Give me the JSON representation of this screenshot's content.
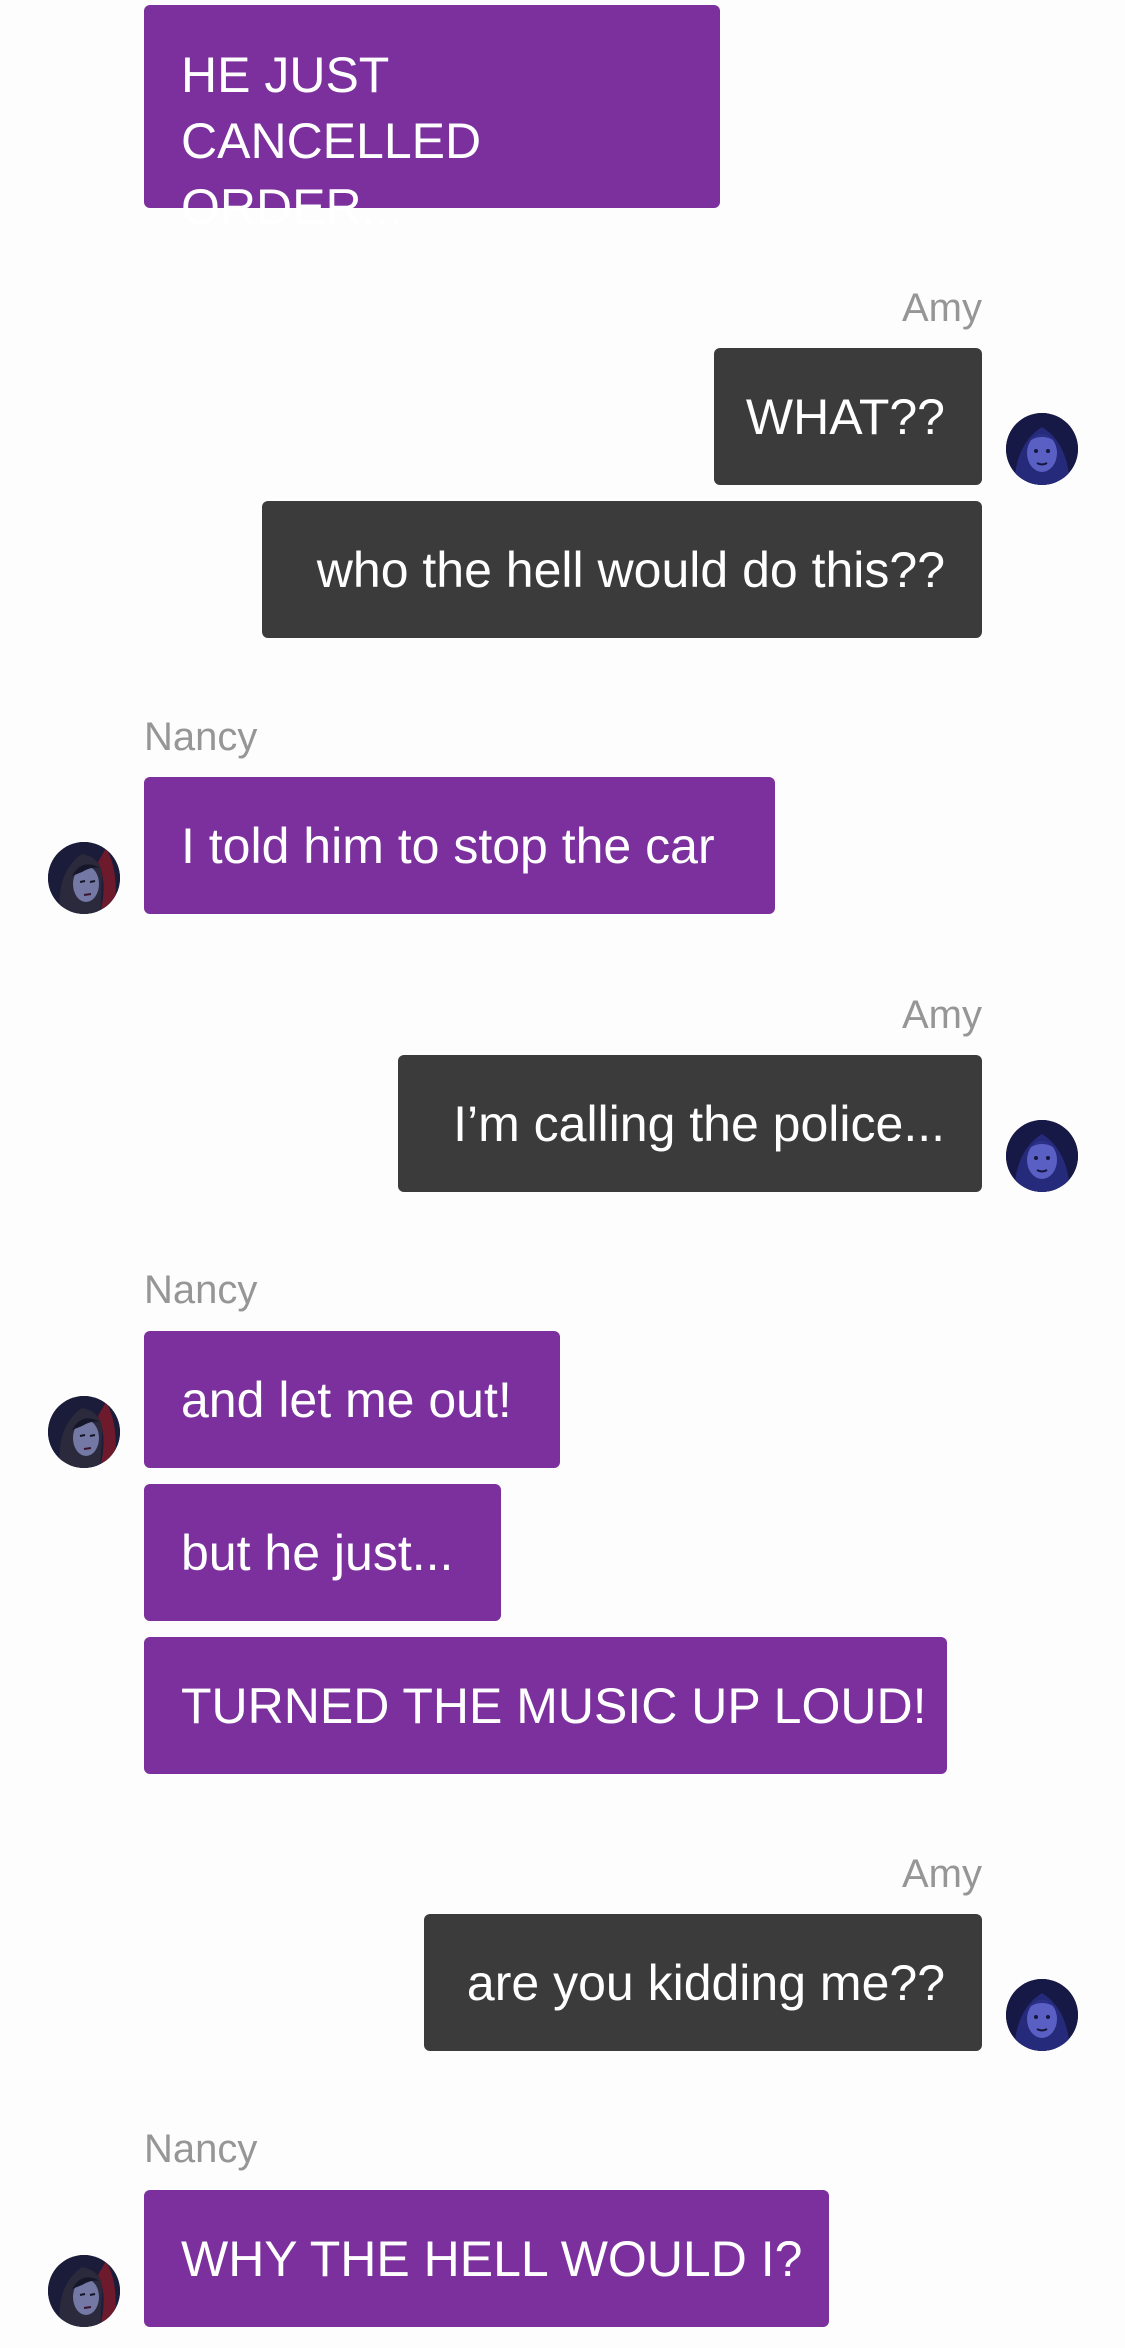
{
  "conversation": {
    "messages": [
      {
        "side": "left",
        "text": "HE JUST CANCELLED ORDER..."
      },
      {
        "side": "right",
        "sender": "Amy",
        "text": "WHAT??"
      },
      {
        "side": "right",
        "text": "who the hell would do this??"
      },
      {
        "side": "left",
        "sender": "Nancy",
        "text": "I told him to stop the car"
      },
      {
        "side": "right",
        "sender": "Amy",
        "text": "I’m calling the police..."
      },
      {
        "side": "left",
        "sender": "Nancy",
        "text": "and let me out!"
      },
      {
        "side": "left",
        "text": "but he just..."
      },
      {
        "side": "left",
        "text": "TURNED THE MUSIC UP LOUD!"
      },
      {
        "side": "right",
        "sender": "Amy",
        "text": "are you kidding me??"
      },
      {
        "side": "left",
        "sender": "Nancy",
        "text": "WHY THE HELL WOULD I?"
      }
    ]
  },
  "colors": {
    "left_bubble": "#7b309e",
    "right_bubble": "#3b3b3b",
    "sender_label": "#969696",
    "background": "#fdfdfd"
  },
  "icons": {
    "nancy_avatar": "avatar-nancy-icon",
    "amy_avatar": "avatar-amy-icon"
  }
}
